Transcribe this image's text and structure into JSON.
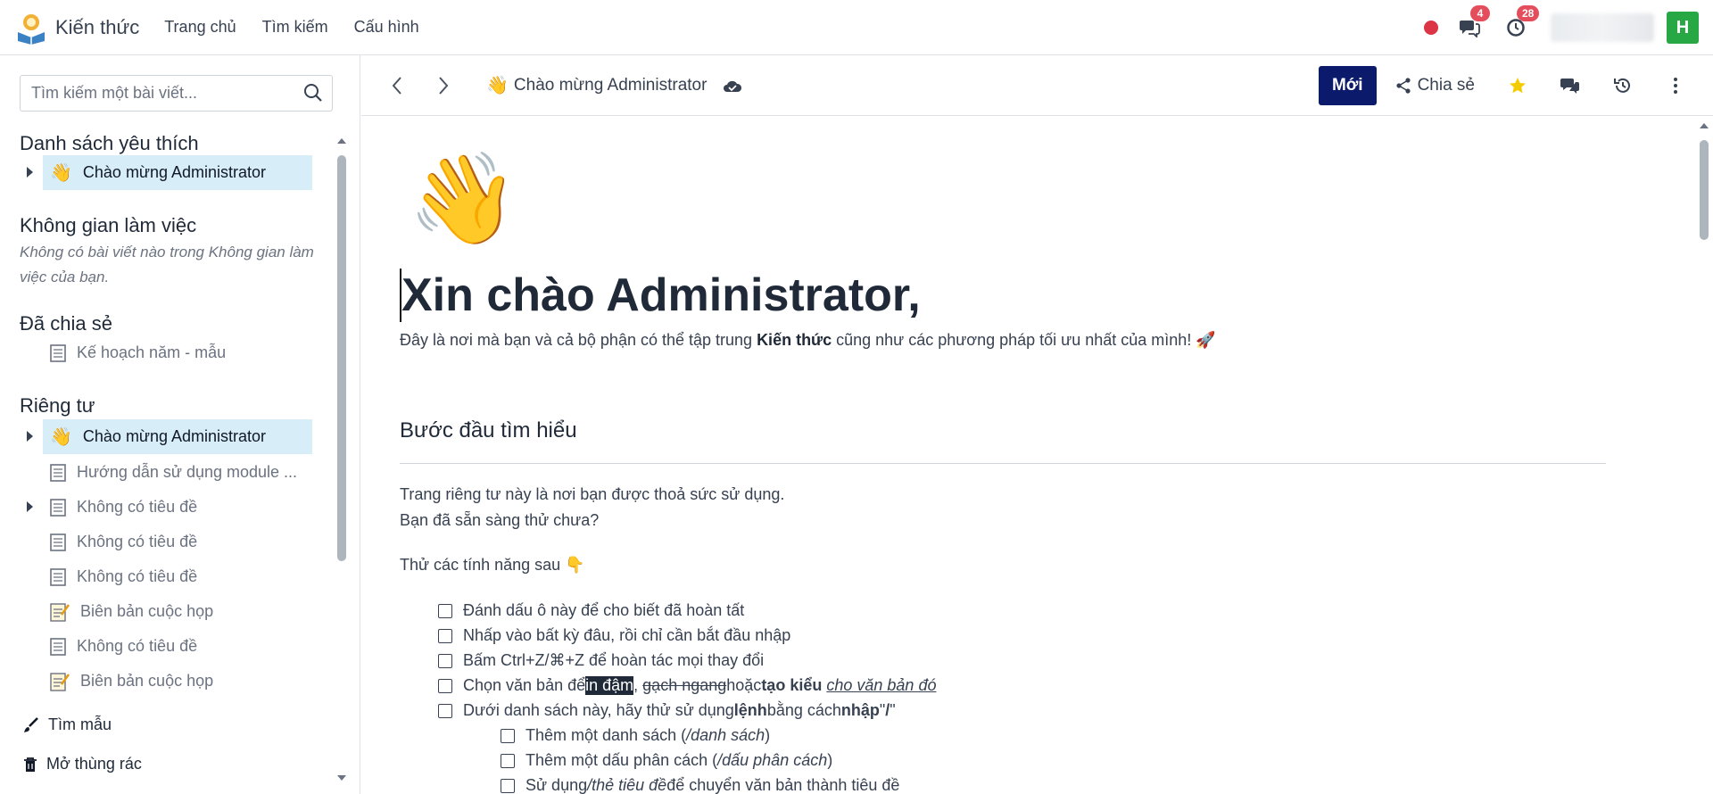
{
  "app": {
    "title": "Kiến thức",
    "menu": [
      "Trang chủ",
      "Tìm kiếm",
      "Cấu hình"
    ],
    "badges": {
      "messages": "4",
      "activities": "28"
    },
    "avatar_letter": "H"
  },
  "sidebar": {
    "search_placeholder": "Tìm kiếm một bài viết...",
    "favorites_title": "Danh sách yêu thích",
    "favorite_item": "Chào mừng Administrator",
    "workspace_title": "Không gian làm việc",
    "workspace_empty": "Không có bài viết nào trong Không gian làm việc của bạn.",
    "shared_title": "Đã chia sẻ",
    "shared_item": "Kế hoạch năm - mẫu",
    "private_title": "Riêng tư",
    "private_items": [
      "Chào mừng Administrator",
      "Hướng dẫn sử dụng module ...",
      "Không có tiêu đề",
      "Không có tiêu đề",
      "Không có tiêu đề",
      "Biên bản cuộc họp",
      "Không có tiêu đề",
      "Biên bản cuộc họp"
    ],
    "templates": "Tìm mẫu",
    "trash": "Mở thùng rác"
  },
  "article_header": {
    "title": "Chào mừng Administrator",
    "new_button": "Mới",
    "share_button": "Chia sẻ"
  },
  "article": {
    "heading": "Xin chào Administrator,",
    "intro_pre": "Đây là nơi mà bạn và cả bộ phận có thể tập trung ",
    "intro_bold": "Kiến thức",
    "intro_post": " cũng như các phương pháp tối ưu nhất của mình! 🚀",
    "section_title": "Bước đầu tìm hiểu",
    "p1": "Trang riêng tư này là nơi bạn được thoả sức sử dụng.",
    "p2": "Bạn đã sẵn sàng thử chưa?",
    "p3": "Thử các tính năng sau 👇",
    "c1": "Đánh dấu ô này để cho biết đã hoàn tất",
    "c2": "Nhấp vào bất kỳ đâu, rồi chỉ cần bắt đầu nhập",
    "c3": "Bấm Ctrl+Z/⌘+Z để hoàn tác mọi thay đổi",
    "c4_a": "Chọn văn bản để ",
    "c4_hl": "in đậm",
    "c4_comma": ",",
    "c4_strike": "gạch ngang",
    "c4_b": " hoặc ",
    "c4_bold": "tạo kiểu",
    "c4_c": " ",
    "c4_italic": "cho văn bản đó",
    "c5_a": "Dưới danh sách này, hãy thử sử dụng ",
    "c5_b1": "lệnh",
    "c5_b": " bằng cách ",
    "c5_b2": "nhập",
    "c5_c": " \"",
    "c5_slash": "/",
    "c5_d": "\"",
    "s1_a": "Thêm một danh sách (",
    "s1_i": "/danh sách",
    "s1_b": ")",
    "s2_a": "Thêm một dấu phân cách (",
    "s2_i": "/dấu phân cách",
    "s2_b": ")",
    "s3_a": "Sử dụng ",
    "s3_i": "/thẻ tiêu đề",
    "s3_b": " để chuyển văn bản thành tiêu đề"
  }
}
